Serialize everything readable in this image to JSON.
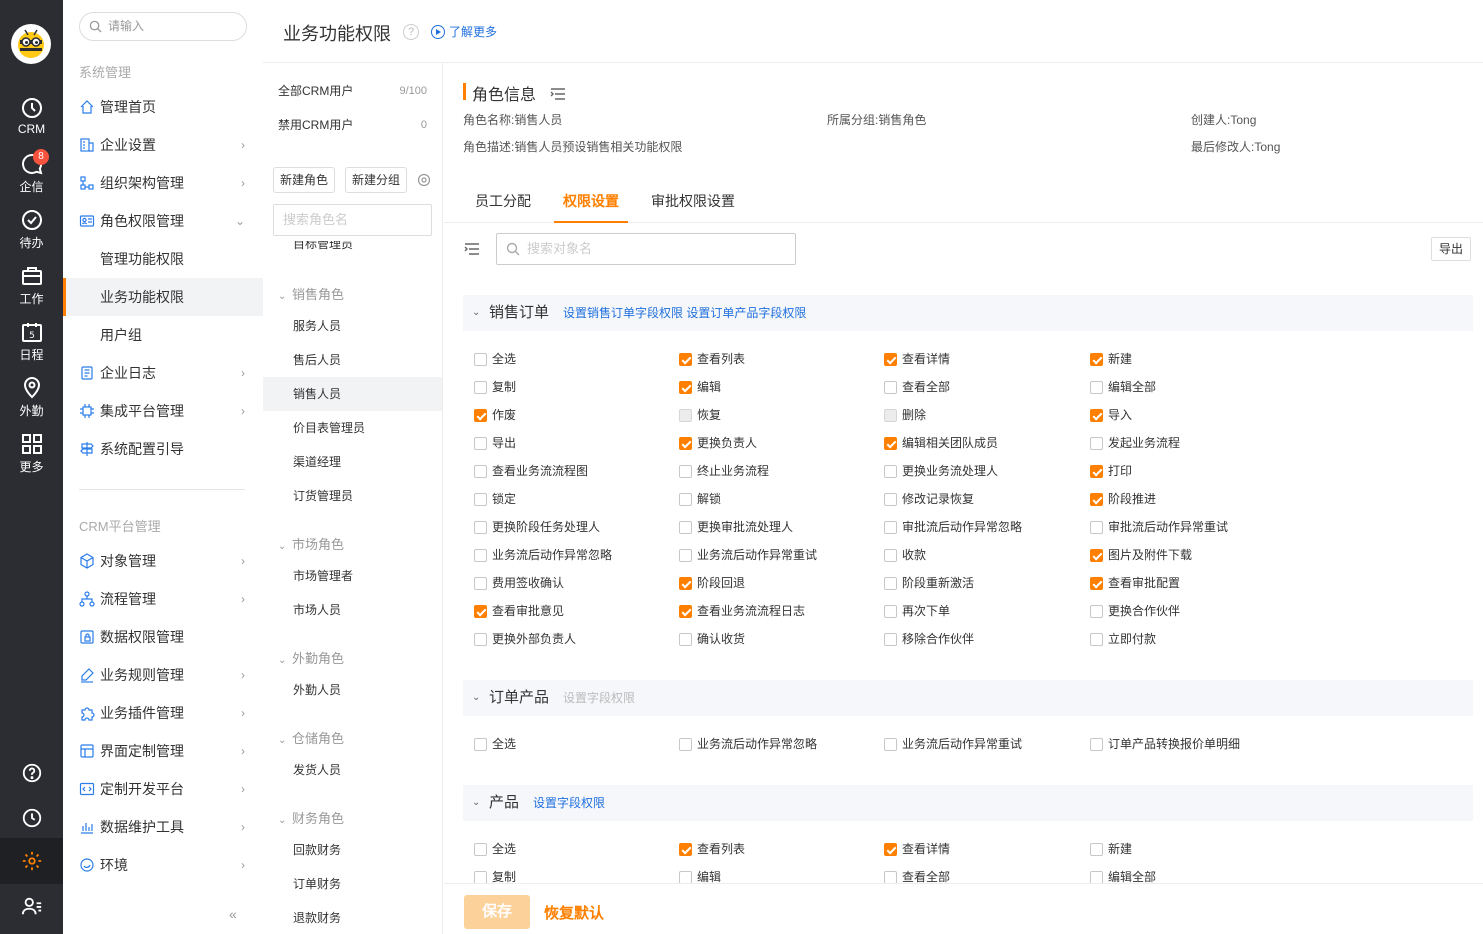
{
  "rail": {
    "items": [
      {
        "label": "CRM",
        "icon": "clock-icon"
      },
      {
        "label": "企信",
        "icon": "chat-icon",
        "badge": "8"
      },
      {
        "label": "待办",
        "icon": "check-circle-icon"
      },
      {
        "label": "工作",
        "icon": "briefcase-icon"
      },
      {
        "label": "日程",
        "icon": "calendar-icon",
        "day": "5"
      },
      {
        "label": "外勤",
        "icon": "location-icon"
      },
      {
        "label": "更多",
        "icon": "grid-icon"
      }
    ]
  },
  "sidebar": {
    "search_placeholder": "请输入",
    "group1_title": "系统管理",
    "group1": [
      {
        "label": "管理首页",
        "icon": "home-icon",
        "chev": ""
      },
      {
        "label": "企业设置",
        "icon": "building-icon",
        "chev": "›"
      },
      {
        "label": "组织架构管理",
        "icon": "org-icon",
        "chev": "›"
      },
      {
        "label": "角色权限管理",
        "icon": "id-card-icon",
        "chev": "⌄"
      }
    ],
    "group1_sub": [
      "管理功能权限",
      "业务功能权限",
      "用户组"
    ],
    "group1b": [
      {
        "label": "企业日志",
        "icon": "log-icon",
        "chev": "›"
      },
      {
        "label": "集成平台管理",
        "icon": "chip-icon",
        "chev": "›"
      },
      {
        "label": "系统配置引导",
        "icon": "signpost-icon",
        "chev": ""
      }
    ],
    "group2_title": "CRM平台管理",
    "group2": [
      {
        "label": "对象管理",
        "icon": "cube-icon",
        "chev": "›"
      },
      {
        "label": "流程管理",
        "icon": "flow-icon",
        "chev": "›"
      },
      {
        "label": "数据权限管理",
        "icon": "data-lock-icon",
        "chev": ""
      },
      {
        "label": "业务规则管理",
        "icon": "rule-icon",
        "chev": "›"
      },
      {
        "label": "业务插件管理",
        "icon": "puzzle-icon",
        "chev": "›"
      },
      {
        "label": "界面定制管理",
        "icon": "layout-icon",
        "chev": "›"
      },
      {
        "label": "定制开发平台",
        "icon": "code-icon",
        "chev": "›"
      },
      {
        "label": "数据维护工具",
        "icon": "bar-chart-icon",
        "chev": "›"
      },
      {
        "label": "环境",
        "icon": "env-icon",
        "chev": "›"
      }
    ]
  },
  "header": {
    "title": "业务功能权限",
    "help": "?",
    "more_link": "了解更多"
  },
  "rolepanel": {
    "users": [
      {
        "label": "全部CRM用户",
        "count": "9/100"
      },
      {
        "label": "禁用CRM用户",
        "count": "0"
      }
    ],
    "new_role": "新建角色",
    "new_group": "新建分组",
    "search_placeholder": "搜索角色名",
    "cut_item": "目标管理员",
    "groups": [
      {
        "name": "销售角色",
        "items": [
          "服务人员",
          "售后人员",
          "销售人员",
          "价目表管理员",
          "渠道经理",
          "订货管理员"
        ]
      },
      {
        "name": "市场角色",
        "items": [
          "市场管理者",
          "市场人员"
        ]
      },
      {
        "name": "外勤角色",
        "items": [
          "外勤人员"
        ]
      },
      {
        "name": "仓储角色",
        "items": [
          "发货人员"
        ]
      },
      {
        "name": "财务角色",
        "items": [
          "回款财务",
          "订单财务",
          "退款财务"
        ]
      }
    ]
  },
  "main": {
    "info_title": "角色信息",
    "role_name_label": "角色名称:",
    "role_name": "销售人员",
    "group_label": "所属分组:",
    "group": "销售角色",
    "creator_label": "创建人:",
    "creator": "Tong",
    "desc_label": "角色描述:",
    "desc": "销售人员预设销售相关功能权限",
    "modifier_label": "最后修改人:",
    "modifier": "Tong",
    "tabs": [
      "员工分配",
      "权限设置",
      "审批权限设置"
    ],
    "obj_search_placeholder": "搜索对象名",
    "export": "导出",
    "sections": [
      {
        "title": "销售订单",
        "links": [
          "设置销售订单字段权限",
          "设置订单产品字段权限"
        ],
        "link_dim": false,
        "perms": [
          {
            "l": "全选",
            "s": "off"
          },
          {
            "l": "查看列表",
            "s": "on"
          },
          {
            "l": "查看详情",
            "s": "on"
          },
          {
            "l": "新建",
            "s": "on"
          },
          {
            "l": "复制",
            "s": "off"
          },
          {
            "l": "编辑",
            "s": "on"
          },
          {
            "l": "查看全部",
            "s": "off"
          },
          {
            "l": "编辑全部",
            "s": "off"
          },
          {
            "l": "作废",
            "s": "on"
          },
          {
            "l": "恢复",
            "s": "dis"
          },
          {
            "l": "删除",
            "s": "dis"
          },
          {
            "l": "导入",
            "s": "on"
          },
          {
            "l": "导出",
            "s": "off"
          },
          {
            "l": "更换负责人",
            "s": "on"
          },
          {
            "l": "编辑相关团队成员",
            "s": "on"
          },
          {
            "l": "发起业务流程",
            "s": "off"
          },
          {
            "l": "查看业务流流程图",
            "s": "off"
          },
          {
            "l": "终止业务流程",
            "s": "off"
          },
          {
            "l": "更换业务流处理人",
            "s": "off"
          },
          {
            "l": "打印",
            "s": "on"
          },
          {
            "l": "锁定",
            "s": "off"
          },
          {
            "l": "解锁",
            "s": "off"
          },
          {
            "l": "修改记录恢复",
            "s": "off"
          },
          {
            "l": "阶段推进",
            "s": "on"
          },
          {
            "l": "更换阶段任务处理人",
            "s": "off"
          },
          {
            "l": "更换审批流处理人",
            "s": "off"
          },
          {
            "l": "审批流后动作异常忽略",
            "s": "off"
          },
          {
            "l": "审批流后动作异常重试",
            "s": "off"
          },
          {
            "l": "业务流后动作异常忽略",
            "s": "off"
          },
          {
            "l": "业务流后动作异常重试",
            "s": "off"
          },
          {
            "l": "收款",
            "s": "off"
          },
          {
            "l": "图片及附件下载",
            "s": "on"
          },
          {
            "l": "费用签收确认",
            "s": "off"
          },
          {
            "l": "阶段回退",
            "s": "on"
          },
          {
            "l": "阶段重新激活",
            "s": "off"
          },
          {
            "l": "查看审批配置",
            "s": "on"
          },
          {
            "l": "查看审批意见",
            "s": "on"
          },
          {
            "l": "查看业务流流程日志",
            "s": "on"
          },
          {
            "l": "再次下单",
            "s": "off"
          },
          {
            "l": "更换合作伙伴",
            "s": "off"
          },
          {
            "l": "更换外部负责人",
            "s": "off"
          },
          {
            "l": "确认收货",
            "s": "off"
          },
          {
            "l": "移除合作伙伴",
            "s": "off"
          },
          {
            "l": "立即付款",
            "s": "off"
          }
        ]
      },
      {
        "title": "订单产品",
        "links": [
          "设置字段权限"
        ],
        "link_dim": true,
        "perms": [
          {
            "l": "全选",
            "s": "off"
          },
          {
            "l": "业务流后动作异常忽略",
            "s": "off"
          },
          {
            "l": "业务流后动作异常重试",
            "s": "off"
          },
          {
            "l": "订单产品转换报价单明细",
            "s": "off"
          }
        ]
      },
      {
        "title": "产品",
        "links": [
          "设置字段权限"
        ],
        "link_dim": false,
        "perms": [
          {
            "l": "全选",
            "s": "off"
          },
          {
            "l": "查看列表",
            "s": "on"
          },
          {
            "l": "查看详情",
            "s": "on"
          },
          {
            "l": "新建",
            "s": "off"
          },
          {
            "l": "复制",
            "s": "off"
          },
          {
            "l": "编辑",
            "s": "off"
          },
          {
            "l": "查看全部",
            "s": "off"
          },
          {
            "l": "编辑全部",
            "s": "off"
          }
        ]
      }
    ],
    "save": "保存",
    "reset": "恢复默认"
  }
}
